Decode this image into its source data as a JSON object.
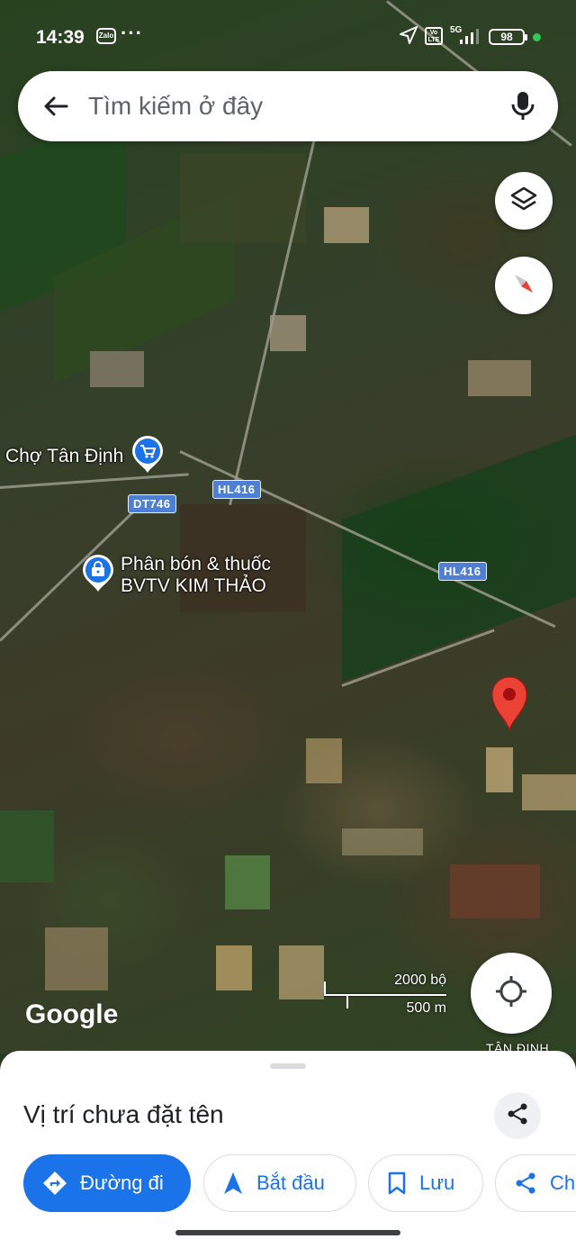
{
  "status_bar": {
    "time": "14:39",
    "zalo": "Zalo",
    "more": "···",
    "volte": "Vo LTE",
    "network": "5G",
    "battery": "98"
  },
  "search": {
    "placeholder": "Tìm kiếm ở đây"
  },
  "map": {
    "pois": [
      {
        "name": "Chợ Tân Định",
        "icon": "shopping-cart-icon"
      },
      {
        "name": "Phân bón & thuốc\nBVTV KIM THẢO",
        "icon": "shopping-bag-icon"
      }
    ],
    "road_shields": [
      "DT746",
      "HL416",
      "HL416"
    ],
    "place_label": "TÂN ĐỊNH",
    "scale": {
      "imperial": "2000 bộ",
      "metric": "500 m"
    },
    "logo": "Google",
    "pin_color": "#ea4335"
  },
  "sheet": {
    "title": "Vị trí chưa đặt tên",
    "actions": [
      {
        "label": "Đường đi",
        "icon": "directions-icon"
      },
      {
        "label": "Bắt đầu",
        "icon": "navigation-arrow-icon"
      },
      {
        "label": "Lưu",
        "icon": "bookmark-icon"
      },
      {
        "label": "Chia sẻ",
        "icon": "share-icon"
      }
    ]
  },
  "colors": {
    "accent": "#1a73e8",
    "shield": "#4f7fd3"
  }
}
